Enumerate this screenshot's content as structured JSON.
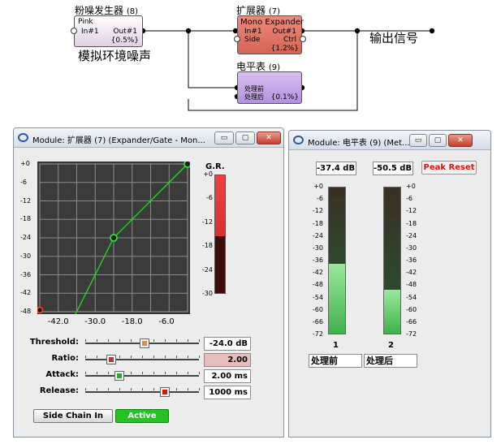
{
  "flow": {
    "noise_gen": {
      "title": "粉噪发生器",
      "id": "(8)",
      "name": "Pink",
      "in": "In#1",
      "out": "Out#1",
      "value": "{0.5%}"
    },
    "expander": {
      "title": "扩展器",
      "id": "(7)",
      "name": "Mono Expander",
      "in": "In#1",
      "side": "Side",
      "out": "Out#1",
      "ctrl": "Ctrl",
      "value": "{1.2%}"
    },
    "level_meter": {
      "title": "电平表",
      "id": "(9)",
      "in1": "处理前",
      "in2": "处理后",
      "value": "{0.1%}"
    },
    "annotation_noise": "模拟环境噪声",
    "annotation_output": "输出信号"
  },
  "expander_window": {
    "title": "Module: 扩展器 (7) (Expander/Gate - Mon...",
    "btn_min": "▭",
    "btn_max": "▢",
    "btn_close": "✕",
    "gr_label": "G.R.",
    "gr_ticks": [
      "+0",
      "-6",
      "-12",
      "-18",
      "-24",
      "-30"
    ],
    "gr_level_db": -15.5,
    "y_ticks": [
      "+0",
      "-6",
      "-12",
      "-18",
      "-24",
      "-30",
      "-36",
      "-42",
      "-48"
    ],
    "x_ticks": [
      "-42.0",
      "-30.0",
      "-18.0",
      "-6.0"
    ],
    "params": [
      {
        "label": "Threshold:",
        "value": "-24.0 dB",
        "fraction": 0.52,
        "color": "#c8934a"
      },
      {
        "label": "Ratio:",
        "value": "2.00",
        "fraction": 0.2,
        "color": "#a04040"
      },
      {
        "label": "Attack:",
        "value": "2.00 ms",
        "fraction": 0.28,
        "color": "#22b022"
      },
      {
        "label": "Release:",
        "value": "1000 ms",
        "fraction": 0.72,
        "color": "#dd1111"
      }
    ],
    "side_chain_label": "Side Chain In",
    "active_label": "Active",
    "colors": {
      "active": "#22c322",
      "curve": "#22dd22",
      "ratio_field": "#e6bcbc"
    }
  },
  "meter_window": {
    "title": "Module: 电平表 (9) (Met...",
    "btn_min": "▭",
    "btn_max": "▢",
    "btn_close": "✕",
    "readout_1": "-37.4 dB",
    "readout_2": "-50.5 dB",
    "peak_reset_label": "Peak Reset",
    "scale": [
      "+0",
      "-6",
      "-12",
      "-18",
      "-24",
      "-30",
      "-36",
      "-42",
      "-48",
      "-54",
      "-60",
      "-66",
      "-72"
    ],
    "meters": [
      {
        "number": "1",
        "name": "处理前",
        "level_db": -37.4
      },
      {
        "number": "2",
        "name": "处理后",
        "level_db": -50.5
      }
    ],
    "colors": {
      "peak_reset": "#dd1111"
    }
  }
}
